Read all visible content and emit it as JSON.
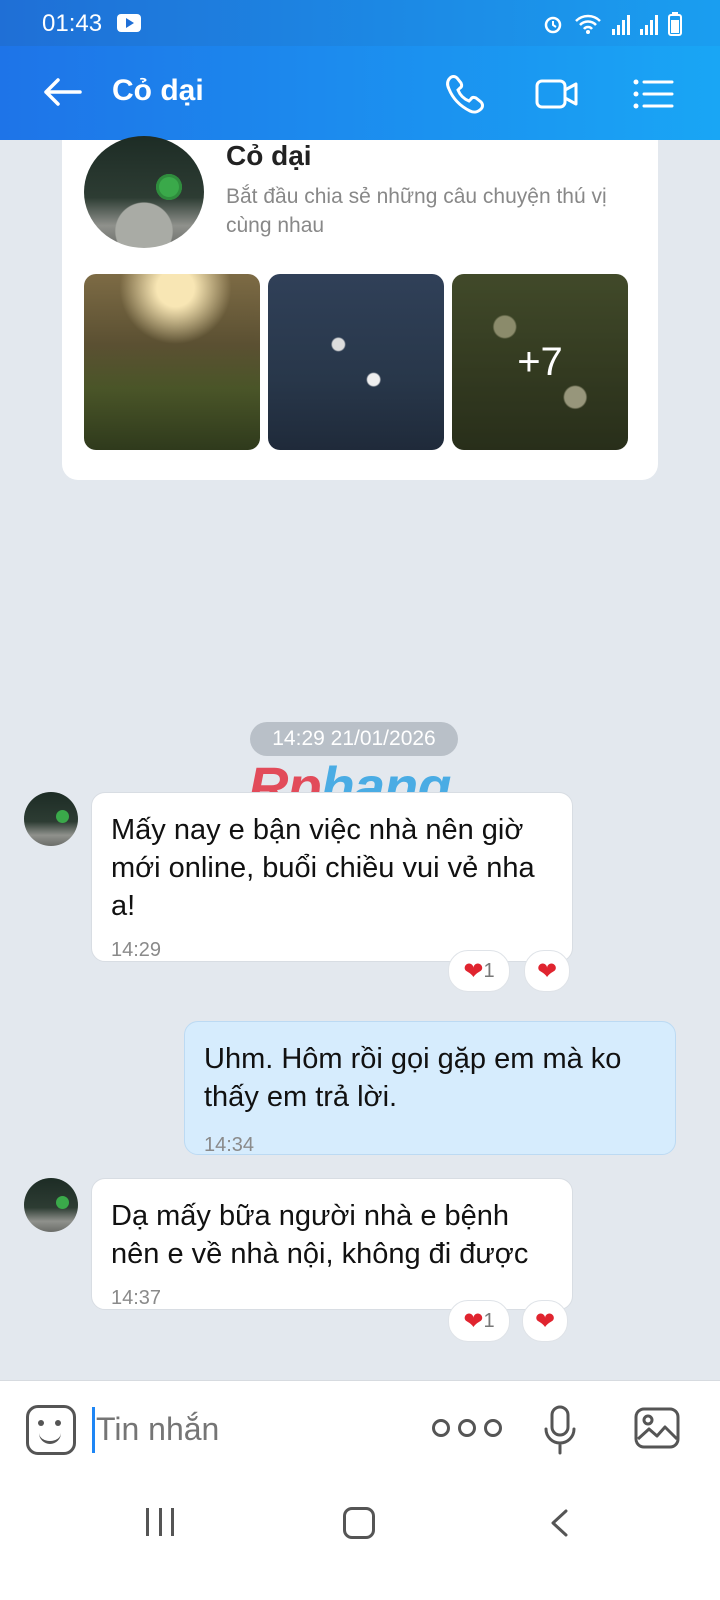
{
  "status": {
    "time": "01:43"
  },
  "header": {
    "title": "Cỏ dại"
  },
  "profile": {
    "name": "Cỏ dại",
    "description": "Bắt đầu chia sẻ những câu chuyện thú vị cùng nhau",
    "more_photos": "+7"
  },
  "date_divider": "14:29 21/01/2026",
  "watermark": {
    "part1": "Rp",
    "part2": "hang"
  },
  "messages": [
    {
      "from": "contact",
      "text": "Mấy nay e bận việc nhà nên giờ mới online, buổi chiều vui vẻ nha a!",
      "time": "14:29",
      "reaction_count": "1",
      "reaction_icon": "heart-icon"
    },
    {
      "from": "me",
      "text": "Uhm. Hôm rồi gọi gặp em mà ko thấy em trả lời.",
      "time": "14:34"
    },
    {
      "from": "contact",
      "text": "Dạ mấy bữa người nhà e bệnh nên e về nhà nội, không đi được",
      "time": "14:37",
      "reaction_count": "1",
      "reaction_icon": "heart-icon"
    }
  ],
  "composer": {
    "placeholder": "Tin nhắn"
  },
  "colors": {
    "header": "#1e74e8",
    "outgoing_bubble": "#d6ecfd",
    "heart": "#e0242f"
  }
}
